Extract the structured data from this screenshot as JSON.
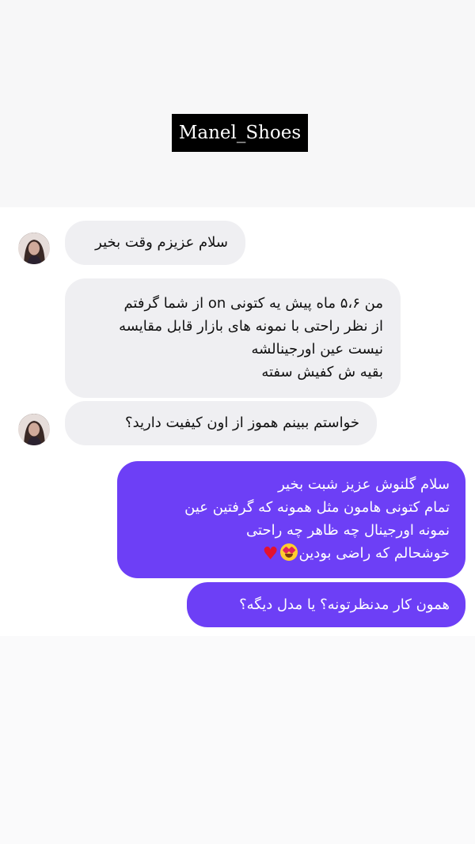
{
  "header": {
    "brand": "Manel_Shoes"
  },
  "conversation": {
    "incoming": [
      {
        "lines": [
          "سلام عزیزم وقت بخیر"
        ]
      },
      {
        "lines": [
          "من ۵،۶ ماه پیش یه کتونی on از شما گرفتم",
          "از نظر راحتی با نمونه های بازار قابل مقایسه",
          "نیست عین اورجینالشه",
          "بقیه ش کفیش سفته"
        ]
      },
      {
        "lines": [
          "خواستم ببینم هموز از اون کیفیت دارید؟"
        ]
      }
    ],
    "outgoing": [
      {
        "lines": [
          "سلام گلنوش عزیز شبت بخیر",
          "تمام کتونی هامون مثل همونه که گرفتین عین",
          "نمونه اورجینال چه ظاهر چه راحتی",
          "خوشحالم که راضی بودین"
        ],
        "emoji": [
          "smiling-heart-eyes-icon",
          "red-heart-icon"
        ]
      },
      {
        "lines": [
          "همون کار مدنظرتونه؟ یا مدل دیگه؟"
        ]
      }
    ],
    "colors": {
      "incoming_bubble": "#efeff2",
      "outgoing_bubble": "#6d3ff6",
      "outgoing_text": "#ffffff",
      "incoming_text": "#111111"
    }
  }
}
